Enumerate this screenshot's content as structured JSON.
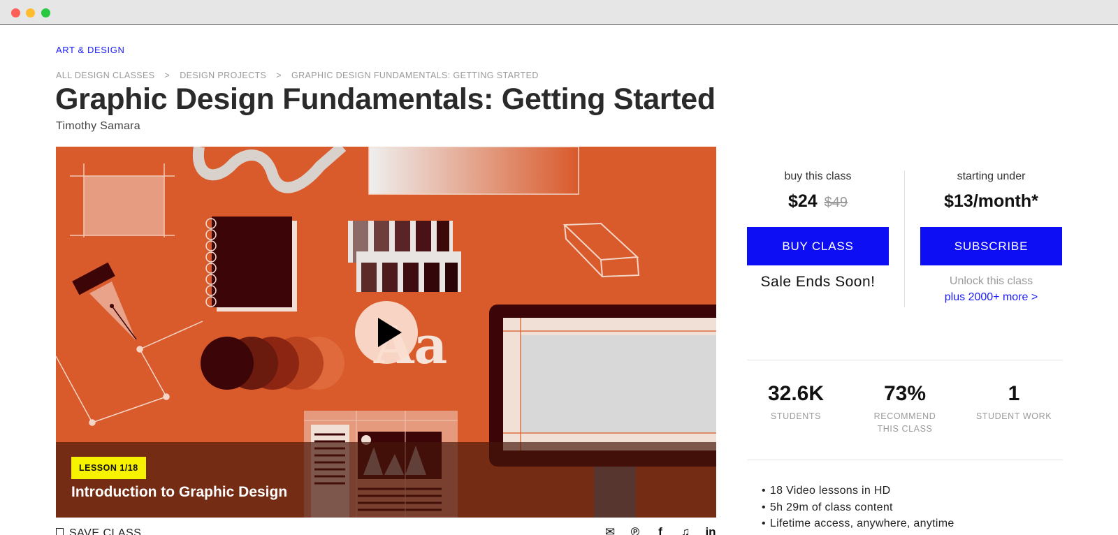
{
  "category": "ART & DESIGN",
  "breadcrumb": [
    "ALL DESIGN CLASSES",
    "DESIGN PROJECTS",
    "GRAPHIC DESIGN FUNDAMENTALS: GETTING STARTED"
  ],
  "breadcrumb_separator": ">",
  "course": {
    "title": "Graphic Design Fundamentals: Getting Started",
    "author": "Timothy Samara"
  },
  "video": {
    "lesson_badge": "LESSON 1/18",
    "lesson_title": "Introduction to Graphic Design",
    "artwork_text": "Aa"
  },
  "actions": {
    "save_label": "SAVE CLASS"
  },
  "buy": {
    "label": "buy this class",
    "price": "$24",
    "old_price": "$49",
    "button": "BUY CLASS",
    "note": "Sale Ends Soon!"
  },
  "subscribe": {
    "label": "starting under",
    "price": "$13/month*",
    "button": "SUBSCRIBE",
    "note": "Unlock this class",
    "link": "plus 2000+ more >"
  },
  "stats": [
    {
      "value": "32.6K",
      "caption": "STUDENTS"
    },
    {
      "value": "73%",
      "caption": "RECOMMEND THIS CLASS"
    },
    {
      "value": "1",
      "caption": "STUDENT WORK"
    }
  ],
  "features": [
    "18 Video lessons in HD",
    "5h 29m of class content",
    "Lifetime access, anywhere, anytime"
  ],
  "colors": {
    "accent": "#0e0ef5",
    "link": "#1a1aff",
    "video_bg": "#d95a2b",
    "badge": "#f7f300"
  }
}
